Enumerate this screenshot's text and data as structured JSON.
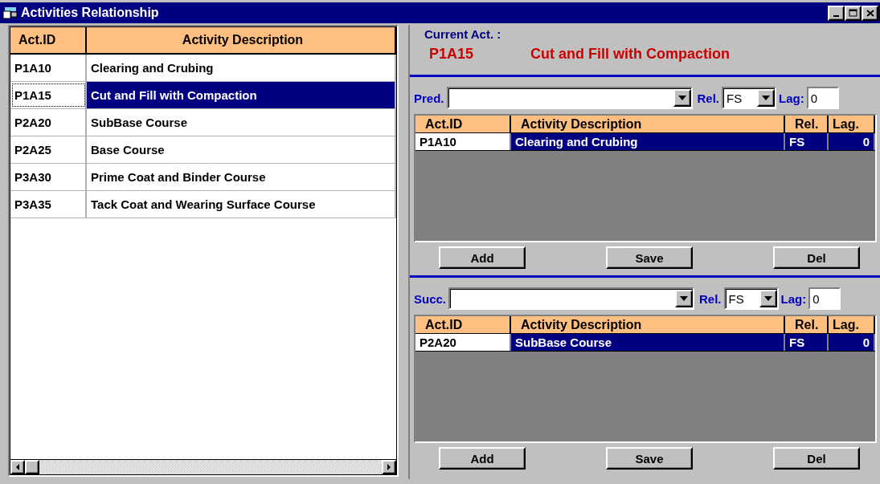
{
  "window": {
    "title": "Activities Relationship"
  },
  "activities": {
    "columns": [
      "Act.ID",
      "Activity Description"
    ],
    "rows": [
      {
        "id": "P1A10",
        "description": "Clearing and Crubing",
        "selected": false,
        "focused": false
      },
      {
        "id": "P1A15",
        "description": "Cut and Fill with Compaction",
        "selected": true,
        "focused": true
      },
      {
        "id": "P2A20",
        "description": "SubBase Course",
        "selected": false,
        "focused": false
      },
      {
        "id": "P2A25",
        "description": "Base Course",
        "selected": false,
        "focused": false
      },
      {
        "id": "P3A30",
        "description": "Prime Coat and Binder Course",
        "selected": false,
        "focused": false
      },
      {
        "id": "P3A35",
        "description": "Tack Coat and Wearing Surface Course",
        "selected": false,
        "focused": false
      }
    ]
  },
  "current": {
    "label": "Current Act. :",
    "id": "P1A15",
    "description": "Cut and Fill with Compaction"
  },
  "panels": [
    {
      "label": "Pred.",
      "rel_label": "Rel.",
      "rel_value": "FS",
      "lag_label": "Lag:",
      "lag_value": "0",
      "columns": [
        "Act.ID",
        "Activity Description",
        "Rel.",
        "Lag."
      ],
      "rows": [
        {
          "id": "P1A10",
          "description": "Clearing and Crubing",
          "rel": "FS",
          "lag": "0",
          "selected": true
        }
      ],
      "buttons": [
        "Add",
        "Save",
        "Del"
      ]
    },
    {
      "label": "Succ.",
      "rel_label": "Rel.",
      "rel_value": "FS",
      "lag_label": "Lag:",
      "lag_value": "0",
      "columns": [
        "Act.ID",
        "Activity Description",
        "Rel.",
        "Lag."
      ],
      "rows": [
        {
          "id": "P2A20",
          "description": "SubBase Course",
          "rel": "FS",
          "lag": "0",
          "selected": true
        }
      ],
      "buttons": [
        "Add",
        "Save",
        "Del"
      ]
    }
  ]
}
